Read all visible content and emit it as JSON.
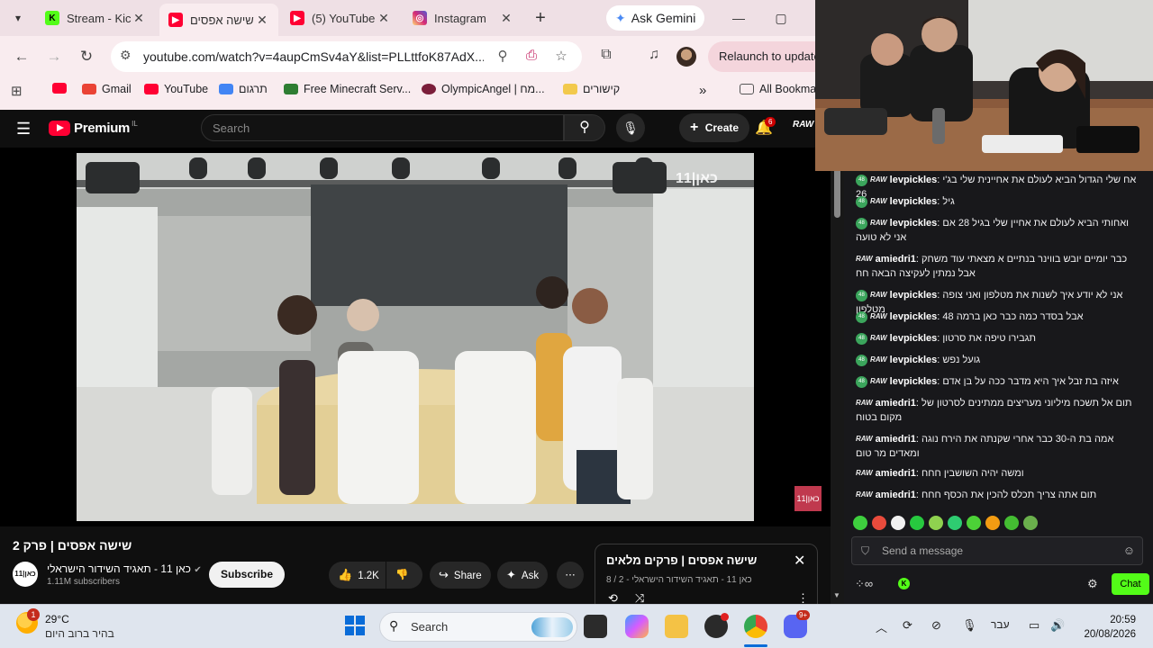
{
  "browser": {
    "tabs": [
      {
        "title": "Stream - Kick",
        "favicon": "kick-icon",
        "color": "#53fc18"
      },
      {
        "title": "שישה אפסים",
        "favicon": "youtube-icon",
        "color": "#ff0033",
        "active": true
      },
      {
        "title": "(5) YouTube",
        "favicon": "youtube-icon",
        "color": "#ff0033"
      },
      {
        "title": "Instagram",
        "favicon": "instagram-icon",
        "color": "#d62976"
      }
    ],
    "gemini_label": "Ask Gemini",
    "url": "youtube.com/watch?v=4aupCmSv4aY&list=PLLttfoK87AdX...",
    "relaunch_label": "Relaunch to update",
    "bookmarks": [
      {
        "label": "",
        "icon": "apps-grid-icon"
      },
      {
        "label": "",
        "icon": "youtube-icon",
        "color": "#ff0033"
      },
      {
        "label": "Gmail",
        "icon": "gmail-icon",
        "color": "#ea4335"
      },
      {
        "label": "YouTube",
        "icon": "youtube-icon",
        "color": "#ff0033"
      },
      {
        "label": "תרגום",
        "icon": "translate-icon",
        "color": "#4285f4"
      },
      {
        "label": "Free Minecraft Serv...",
        "icon": "minecraft-icon",
        "color": "#2e7d32"
      },
      {
        "label": "OlympicAngel | מח...",
        "icon": "avatar-icon",
        "color": "#7b1e3a"
      },
      {
        "label": "קישורים",
        "icon": "links-icon",
        "color": "#f2c94c"
      },
      {
        "label": "All Bookmarks",
        "icon": "folder-icon",
        "color": "#555"
      }
    ]
  },
  "youtube": {
    "brand": "Premium",
    "country": "IL",
    "search_placeholder": "Search",
    "create_label": "Create",
    "notification_count": "6",
    "channel_badge_text": "RAW",
    "video_title": "שישה אפסים | פרק 2",
    "channel_name": "כאן 11 - תאגיד השידור הישראלי",
    "channel_logo_text": "כאן|11",
    "subscribers": "1.11M subscribers",
    "subscribe_label": "Subscribe",
    "like_count": "1.2K",
    "share_label": "Share",
    "ask_label": "Ask",
    "watermark": "כאן|11",
    "corner_logo": "כאן|11",
    "playlist": {
      "title": "שישה אפסים | פרקים מלאים",
      "subtitle": "כאן 11 - תאגיד השידור הישראלי - 2 / 8"
    }
  },
  "chat": {
    "messages": [
      {
        "user": "levpickles",
        "badge": "green",
        "text": "אח שלי הגדול הביא לעולם את אחיינית שלי בג'י 26"
      },
      {
        "user": "levpickles",
        "badge": "green",
        "text": "גיל"
      },
      {
        "user": "levpickles",
        "badge": "green",
        "text": "ואחותי הביא לעולם את אחיין שלי בגיל 28 אם אני לא טועה"
      },
      {
        "user": "amiedri1",
        "badge": "raw",
        "text": "כבר יומיים יובש בווינר בנתיים א מצאתי עוד משחק אבל נמתין לעקיצה הבאה חח"
      },
      {
        "user": "levpickles",
        "badge": "green",
        "text": "אני לא יודע איך לשנות את מטלפון ואני צופה מטלפון"
      },
      {
        "user": "levpickles",
        "badge": "green",
        "text": "אבל בסדר כמה כבר כאן ברמה 48"
      },
      {
        "user": "levpickles",
        "badge": "green",
        "text": "תגבירו טיפה את סרטון"
      },
      {
        "user": "levpickles",
        "badge": "green",
        "text": "גועל נפש"
      },
      {
        "user": "levpickles",
        "badge": "green",
        "text": "איזה בת זבל איך היא מדבר ככה על בן אדם"
      },
      {
        "user": "amiedri1",
        "badge": "raw",
        "text": "תום אל תשכח מיליוני מעריצים ממתינים לסרטון של מקום בטוח"
      },
      {
        "user": "amiedri1",
        "badge": "raw",
        "text": "אמה בת ה-30 כבר אחרי שקנתה את הירח נוגה ומאדים מר טום"
      },
      {
        "user": "amiedri1",
        "badge": "raw",
        "text": "ומשה יהיה השושבין חחח"
      },
      {
        "user": "amiedri1",
        "badge": "raw",
        "text": "תום אתה צריך תכלס להכין את הכסף חחח"
      }
    ],
    "badge_text": "RAW",
    "level_badge": "48",
    "send_placeholder": "Send a message",
    "chat_button": "Chat",
    "kick_letter": "K",
    "emote_colors": [
      "#3ecf3e",
      "#e94b3c",
      "#f1f1f1",
      "#27c93f",
      "#8fd14f",
      "#2ecc71",
      "#4cd137",
      "#f39c12",
      "#44bd32",
      "#6ab04c"
    ]
  },
  "taskbar": {
    "weather_badge": "1",
    "temperature": "29°C",
    "weather_desc": "בהיר ברוב היום",
    "search_label": "Search",
    "language": "עבר",
    "time": "20:59",
    "date": "20/08/2026",
    "discord_badge": "9+"
  }
}
